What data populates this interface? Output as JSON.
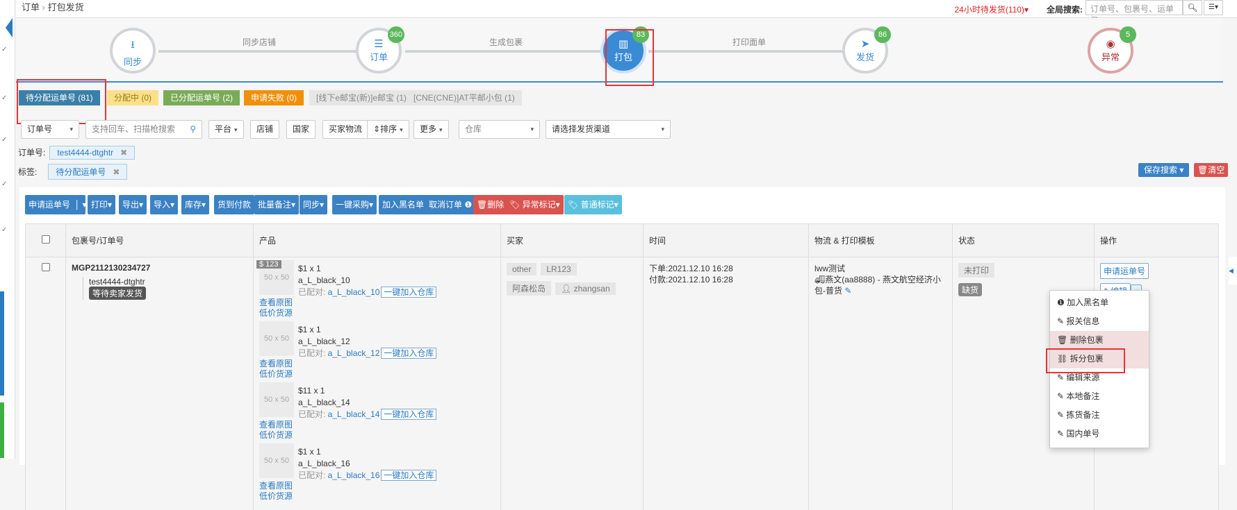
{
  "breadcrumb": {
    "root": "订单",
    "sep": "›",
    "current": "打包发货"
  },
  "header": {
    "urgent": "24小时待发货(110)▾",
    "search_label": "全局搜索:",
    "search_placeholder": "订单号、包裹号、运单号"
  },
  "steps": [
    {
      "name": "同步",
      "icon": "download-icon"
    },
    {
      "name": "订单",
      "icon": "server-icon",
      "badge": "360"
    },
    {
      "name": "打包",
      "icon": "barcode-icon",
      "badge": "83",
      "active": true
    },
    {
      "name": "发货",
      "icon": "send-icon",
      "badge": "86"
    },
    {
      "name": "异常",
      "icon": "eye-slash-icon",
      "badge": "5"
    }
  ],
  "step_links": [
    "同步店铺",
    "生成包裹",
    "打印面单"
  ],
  "tabs": [
    {
      "label": "待分配运单号 (81)",
      "color": "#3a7fa8"
    },
    {
      "label": "分配中 (0)",
      "color": "#fbe08a"
    },
    {
      "label": "已分配运单号 (2)",
      "color": "#7aab57"
    },
    {
      "label": "申请失败 (0)",
      "color": "#f0900a"
    },
    {
      "label": "[线下e邮宝(新)]e邮宝 (1)",
      "color": "#e6e6e6"
    },
    {
      "label": "[CNE(CNE)]AT平邮小包 (1)",
      "color": "#e6e6e6"
    }
  ],
  "filters": {
    "field": "订单号",
    "search_placeholder": "支持回车、扫描枪搜索",
    "platform": "平台",
    "shop": "店铺",
    "country": "国家",
    "buyer_logistics": "买家物流",
    "sort": "排序",
    "more": "更多",
    "warehouse": "仓库",
    "channel": "请选择发货渠道"
  },
  "active_filters": {
    "order_label": "订单号:",
    "order_value": "test4444-dtghtr",
    "tag_label": "标签:",
    "tag_value": "待分配运单号"
  },
  "save_search": "保存搜索",
  "clear": "清空",
  "toolbar": [
    "申请运单号",
    "打印",
    "导出",
    "导入",
    "库存",
    "货到付款",
    "批量备注",
    "同步",
    "一键采购",
    "加入黑名单",
    "取消订单",
    "删除",
    "异常标记",
    "普通标记"
  ],
  "columns": [
    "包裹号/订单号",
    "产品",
    "买家",
    "时间",
    "物流 & 打印模板",
    "状态",
    "操作"
  ],
  "row": {
    "package_no": "MGP2112130234727",
    "order_no": "test4444-dtghtr",
    "order_status": "等待卖家发货",
    "price_tag": "$ 123",
    "products": [
      {
        "price": "$1 x 1",
        "sku": "a_L_black_10",
        "matched": "a_L_black_10"
      },
      {
        "price": "$1 x 1",
        "sku": "a_L_black_12",
        "matched": "a_L_black_12"
      },
      {
        "price": "$11 x 1",
        "sku": "a_L_black_14",
        "matched": "a_L_black_14"
      },
      {
        "price": "$1 x 1",
        "sku": "a_L_black_16",
        "matched": "a_L_black_16"
      }
    ],
    "img_placeholder": "50 x 50",
    "view_image": "查看原图",
    "low_price": "低价货源",
    "matched_label": "已配对: ",
    "add_warehouse": "一键加入仓库",
    "buyer_tags": [
      "other",
      "LR123",
      "阿森松岛",
      "zhangsan"
    ],
    "order_time": "下单:2021.12.10 16:28",
    "pay_time": "付款:2021.12.10 16:28",
    "logistics_name": "lww测试",
    "logistics_template": "燕文(aa8888) - 燕文航空经济小包-普货",
    "status_print": "未打印",
    "status_stock": "缺货",
    "op_apply": "申请运单号",
    "op_edit": "编辑"
  },
  "menu": [
    {
      "label": "加入黑名单",
      "icon": "info-icon"
    },
    {
      "label": "报关信息",
      "icon": "edit-icon"
    },
    {
      "label": "删除包裹",
      "icon": "trash-icon",
      "highlight": true
    },
    {
      "label": "拆分包裹",
      "icon": "unlink-icon",
      "highlight": true
    },
    {
      "label": "编辑来源",
      "icon": "edit-icon"
    },
    {
      "label": "本地备注",
      "icon": "edit-icon"
    },
    {
      "label": "拣货备注",
      "icon": "edit-icon"
    },
    {
      "label": "国内单号",
      "icon": "edit-icon"
    }
  ]
}
